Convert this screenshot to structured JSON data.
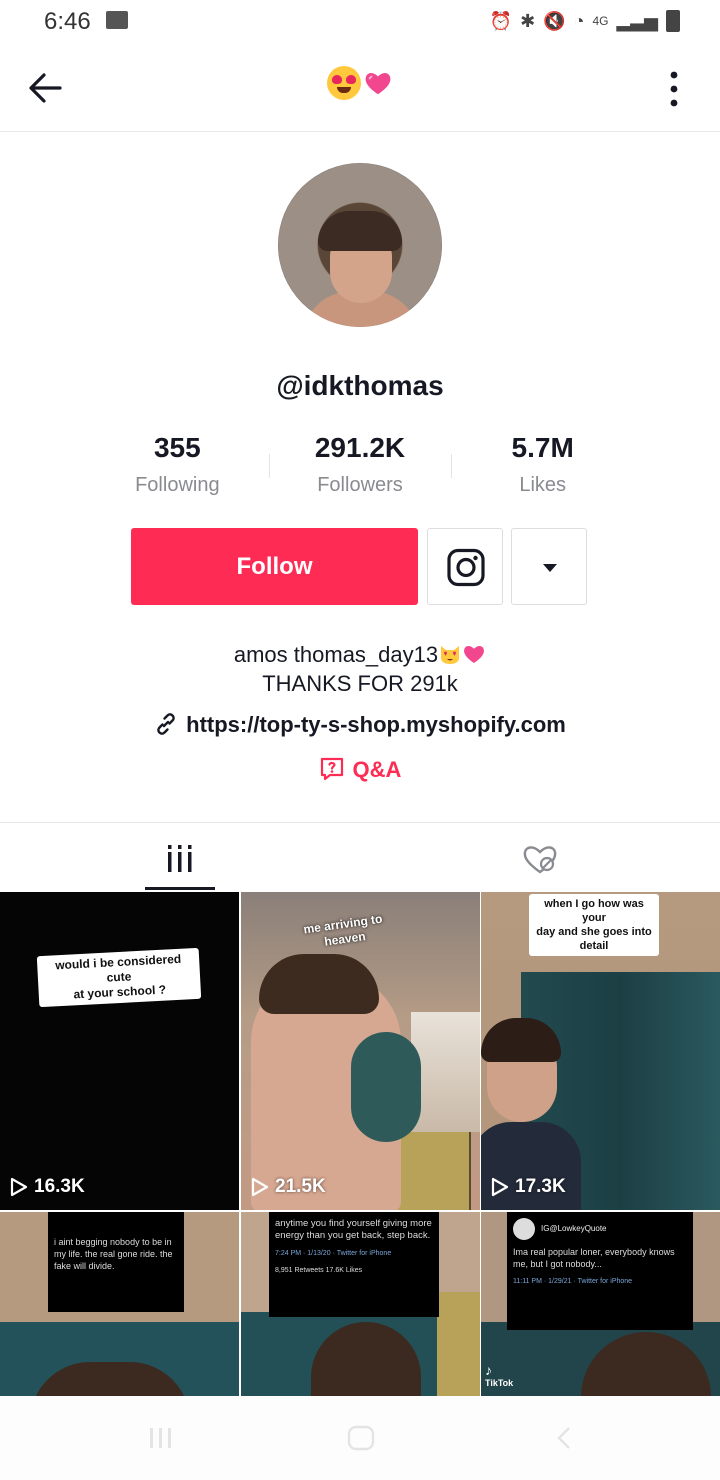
{
  "status_bar": {
    "time": "6:46",
    "network": "4G"
  },
  "header": {
    "title_emoji": "😍💗"
  },
  "profile": {
    "username": "@idkthomas",
    "stats": [
      {
        "value": "355",
        "label": "Following"
      },
      {
        "value": "291.2K",
        "label": "Followers"
      },
      {
        "value": "5.7M",
        "label": "Likes"
      }
    ],
    "follow_label": "Follow",
    "bio_line1": "amos thomas_day13",
    "bio_line2": "THANKS FOR 291k",
    "link": "https://top-ty-s-shop.myshopify.com",
    "qa_label": "Q&A"
  },
  "tabs": [
    "videos",
    "liked"
  ],
  "videos": [
    {
      "views": "16.3K",
      "caption": "would i be considered cute\nat your school ?"
    },
    {
      "views": "21.5K",
      "caption": "me arriving to heaven"
    },
    {
      "views": "17.3K",
      "caption": "when I go how was your\nday and she goes into\ndetail"
    },
    {
      "tweet": "i aint begging nobody to be in my life. the real gone ride. the fake will divide."
    },
    {
      "tweet": "anytime you find yourself giving more energy than you get back, step back.",
      "tweet_meta": "7:24 PM · 1/13/20 · Twitter for iPhone",
      "tweet_stats": "8,951 Retweets  17.6K Likes"
    },
    {
      "tweet_handle": "IG@LowkeyQuote",
      "tweet": "Ima real popular loner, everybody knows me, but I got nobody...",
      "tweet_meta": "11:11 PM · 1/29/21 · Twitter for iPhone",
      "watermark": "TikTok"
    }
  ],
  "colors": {
    "accent": "#fe2c55",
    "text": "#161823",
    "muted": "#8a8b91"
  }
}
